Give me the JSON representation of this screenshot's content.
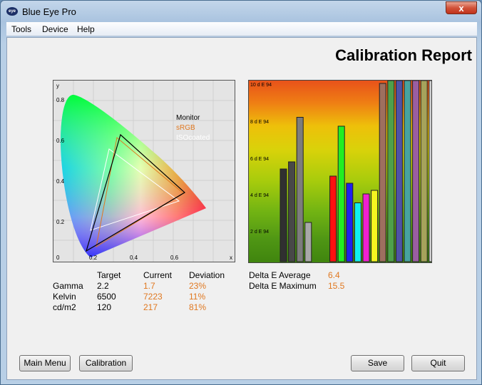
{
  "window": {
    "title": "Blue Eye Pro",
    "close_glyph": "x"
  },
  "menu": [
    "Tools",
    "Device",
    "Help"
  ],
  "report_title": "Calibration Report",
  "cie": {
    "axis_y": "y",
    "axis_x": "x",
    "y_ticks": [
      "0.8",
      "0.6",
      "0.4",
      "0.2",
      "0"
    ],
    "x_ticks": [
      "0.2",
      "0.4",
      "0.6"
    ],
    "legend": [
      {
        "label": "Monitor",
        "color": "#000000"
      },
      {
        "label": "sRGB",
        "color": "#e07820"
      },
      {
        "label": "ISOcoated",
        "color": "#ffffff"
      }
    ]
  },
  "chart_data": {
    "type": "bar",
    "ylabel_unit": "d E 94",
    "y_ticks": [
      "10 d E 94",
      "8 d E 94",
      "6 d E 94",
      "4 d E 94",
      "2 d E 94"
    ],
    "ylim": [
      0,
      10
    ],
    "grid": false,
    "values": [
      5.2,
      5.6,
      8.1,
      2.2,
      0,
      0,
      4.8,
      7.6,
      4.4,
      3.3,
      3.8,
      4.0,
      10.0,
      10.5,
      10.5,
      10.5,
      10.5,
      10.3,
      10.5
    ],
    "colors": [
      "#303030",
      "#484848",
      "#7d7d7d",
      "#a8a8a8",
      "none",
      "none",
      "#ff1010",
      "#22ee22",
      "#2020ee",
      "#10f0f0",
      "#f020d0",
      "#f5f520",
      "#9e6f5f",
      "#4ea04a",
      "#4f52a7",
      "#47a3a0",
      "#9a5ea1",
      "#a6a35b",
      "#cfcfcf"
    ]
  },
  "stats": {
    "headers": {
      "target": "Target",
      "current": "Current",
      "deviation": "Deviation"
    },
    "rows": [
      {
        "label": "Gamma",
        "target": "2.2",
        "current": "1.7",
        "deviation": "23%"
      },
      {
        "label": "Kelvin",
        "target": "6500",
        "current": "7223",
        "deviation": "11%"
      },
      {
        "label": "cd/m2",
        "target": "120",
        "current": "217",
        "deviation": "81%"
      }
    ],
    "delta_e": [
      {
        "label": "Delta E Average",
        "value": "6.4"
      },
      {
        "label": "Delta E Maximum",
        "value": "15.5"
      }
    ]
  },
  "buttons": {
    "main_menu": "Main Menu",
    "calibration": "Calibration",
    "save": "Save",
    "quit": "Quit"
  }
}
